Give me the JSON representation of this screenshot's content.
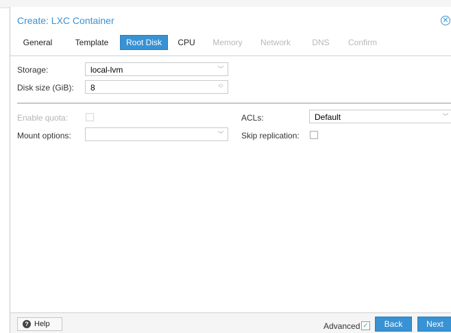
{
  "dialog": {
    "title": "Create: LXC Container",
    "close_icon": "close-icon"
  },
  "tabs": [
    {
      "label": "General",
      "state": "normal"
    },
    {
      "label": "Template",
      "state": "normal"
    },
    {
      "label": "Root Disk",
      "state": "active"
    },
    {
      "label": "CPU",
      "state": "normal"
    },
    {
      "label": "Memory",
      "state": "disabled"
    },
    {
      "label": "Network",
      "state": "disabled"
    },
    {
      "label": "DNS",
      "state": "disabled"
    },
    {
      "label": "Confirm",
      "state": "disabled"
    }
  ],
  "form": {
    "storage_label": "Storage:",
    "storage_value": "local-lvm",
    "disk_size_label": "Disk size (GiB):",
    "disk_size_value": "8",
    "enable_quota_label": "Enable quota:",
    "mount_options_label": "Mount options:",
    "mount_options_value": "",
    "acls_label": "ACLs:",
    "acls_value": "Default",
    "skip_replication_label": "Skip replication:"
  },
  "footer": {
    "help_label": "Help",
    "advanced_label": "Advanced",
    "back_label": "Back",
    "next_label": "Next"
  },
  "colors": {
    "accent": "#3892d4",
    "disabled_text": "#b8b8b8"
  }
}
